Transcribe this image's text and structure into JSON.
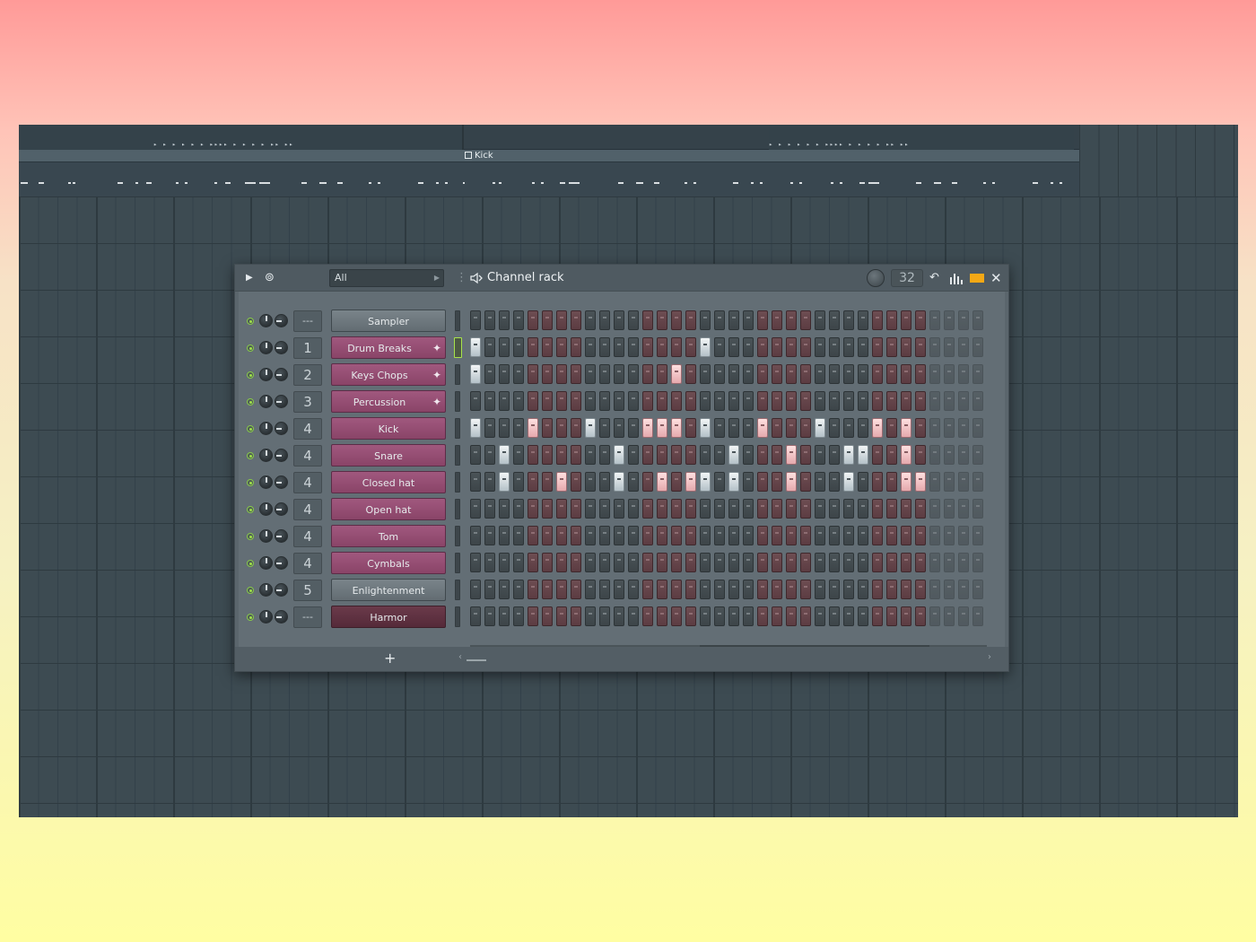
{
  "playlist": {
    "clip_name": "Kick"
  },
  "channel_rack": {
    "title": "Channel rack",
    "filter": "All",
    "steps_count": "32",
    "add_label": "+",
    "channels": [
      {
        "name": "Sampler",
        "mixer": "---",
        "style": "gray",
        "wave": false,
        "selected": false,
        "steps": []
      },
      {
        "name": "Drum Breaks",
        "mixer": "1",
        "style": "pink",
        "wave": true,
        "selected": true,
        "steps": [
          0,
          16
        ]
      },
      {
        "name": "Keys Chops",
        "mixer": "2",
        "style": "pink",
        "wave": true,
        "selected": false,
        "steps": [
          0,
          14
        ]
      },
      {
        "name": "Percussion",
        "mixer": "3",
        "style": "pink",
        "wave": true,
        "selected": false,
        "steps": []
      },
      {
        "name": "Kick",
        "mixer": "4",
        "style": "pink",
        "wave": false,
        "selected": false,
        "steps": [
          0,
          4,
          8,
          12,
          13,
          14,
          16,
          20,
          24,
          28,
          30
        ]
      },
      {
        "name": "Snare",
        "mixer": "4",
        "style": "pink",
        "wave": false,
        "selected": false,
        "steps": [
          2,
          10,
          18,
          22,
          26,
          27,
          30
        ]
      },
      {
        "name": "Closed hat",
        "mixer": "4",
        "style": "pink",
        "wave": false,
        "selected": false,
        "steps": [
          2,
          6,
          10,
          13,
          15,
          16,
          18,
          22,
          26,
          30,
          31
        ]
      },
      {
        "name": "Open hat",
        "mixer": "4",
        "style": "pink",
        "wave": false,
        "selected": false,
        "steps": []
      },
      {
        "name": "Tom",
        "mixer": "4",
        "style": "pink",
        "wave": false,
        "selected": false,
        "steps": []
      },
      {
        "name": "Cymbals",
        "mixer": "4",
        "style": "pink",
        "wave": false,
        "selected": false,
        "steps": []
      },
      {
        "name": "Enlightenment",
        "mixer": "5",
        "style": "gray",
        "wave": false,
        "selected": false,
        "steps": []
      },
      {
        "name": "Harmor",
        "mixer": "---",
        "style": "dark",
        "wave": false,
        "selected": false,
        "steps": []
      }
    ]
  },
  "icons": {
    "play": "play-icon",
    "swing": "swing-icon",
    "speaker": "speaker-icon",
    "undo": "undo-icon",
    "graph": "graph-editor-icon",
    "layout": "step-layout-icon",
    "close": "close-icon",
    "wave": "waveform-icon"
  },
  "colors": {
    "step_on": "#eef2f4",
    "step_on_red": "#f7c8cb",
    "channel_pink": "#964f76",
    "led_green": "#9fe04a",
    "accent_orange": "#f4a815"
  }
}
